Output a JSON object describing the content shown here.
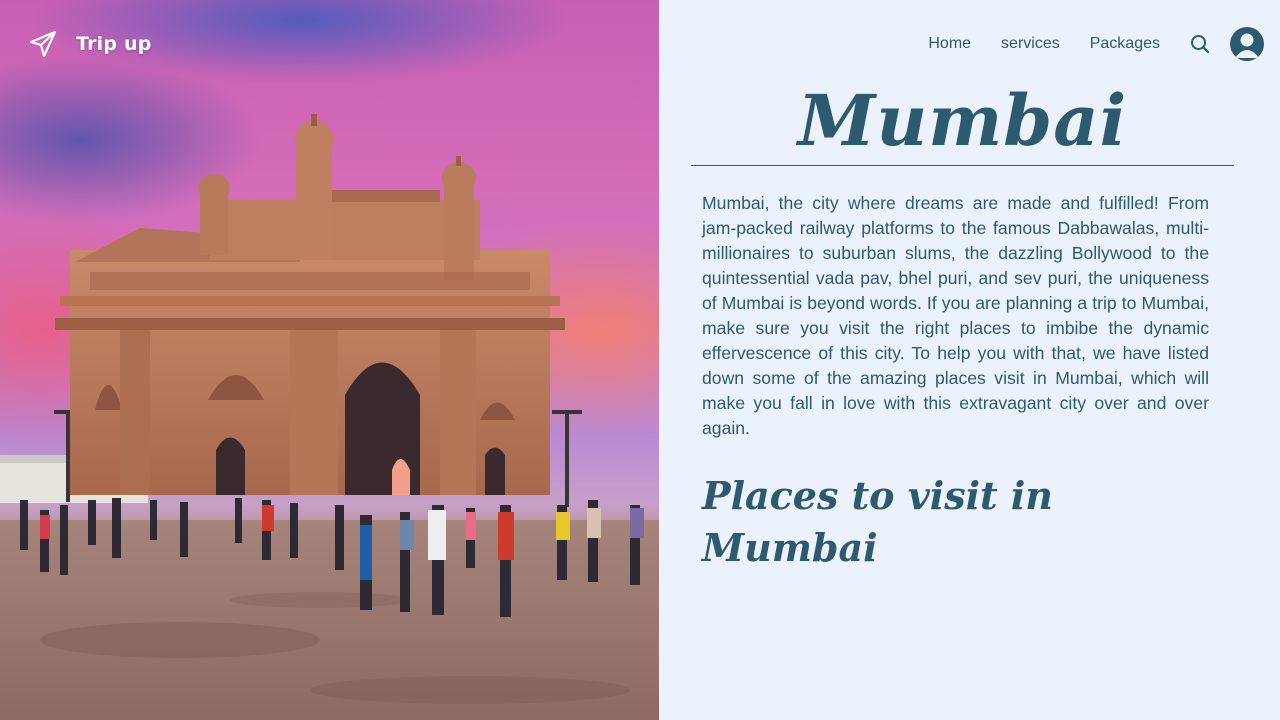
{
  "brand": {
    "name": "Trip up",
    "logo_icon": "paper-plane-icon"
  },
  "photo": {
    "subject": ""
  },
  "nav": {
    "links": [
      {
        "label": "Home"
      },
      {
        "label": "services"
      },
      {
        "label": "Packages"
      }
    ],
    "search_icon": "search-icon",
    "profile_icon": "user-avatar-icon"
  },
  "main": {
    "title": "Mumbai",
    "description": "Mumbai, the city where dreams are made and fulfilled! From jam-packed railway platforms to the famous Dabbawalas, multi-millionaires to suburban slums, the dazzling Bollywood to the quintessential vada pav, bhel puri, and sev puri, the uniqueness of Mumbai is beyond words. If you are planning a trip to Mumbai, make sure you visit the right places to imbibe the dynamic effervescence of this city. To help you with that, we have listed down some of the amazing places visit in Mumbai, which will make you fall in love with this extravagant city over and over again.",
    "section_title": "Places to visit in Mumbai"
  },
  "colors": {
    "primary": "#2e5a6f",
    "panel_background": "#ebf2fc",
    "brand_text": "#ffffff"
  }
}
